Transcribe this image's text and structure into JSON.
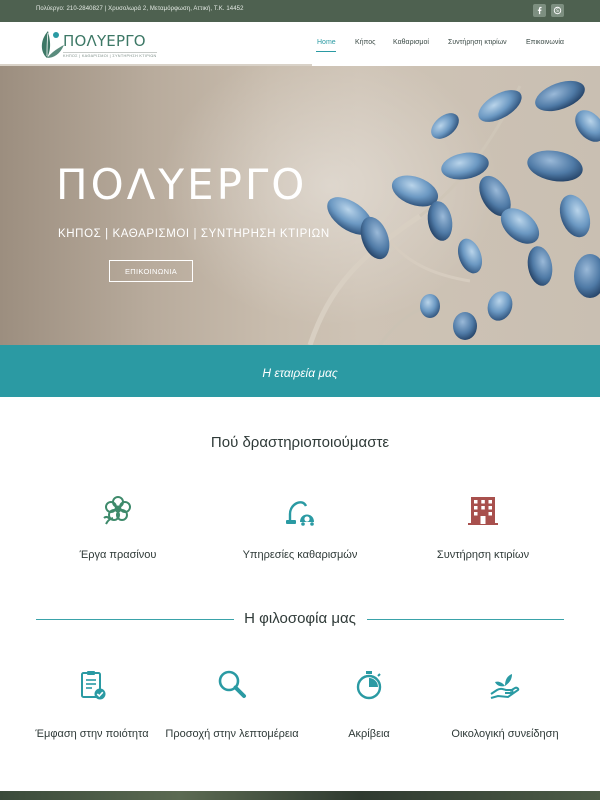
{
  "topbar": {
    "info": "Πολύεργο: 210-2840827 | Χρυσολωρά 2, Μεταμόρφωση, Αττική, Τ.Κ. 14452",
    "social": [
      "facebook-icon",
      "skype-icon"
    ]
  },
  "header": {
    "logo_text": "ΠΟΛΥΕΡΓΟ",
    "logo_sub": "ΚΗΠΟΣ | ΚΑΘΑΡΙΣΜΟΙ | ΣΥΝΤΗΡΗΣΗ ΚΤΙΡΙΩΝ",
    "nav": [
      "Home",
      "Κήπος",
      "Καθαρισμοί",
      "Συντήρηση κτιρίων",
      "Επικοινωνία"
    ],
    "active_nav": "Home"
  },
  "hero": {
    "title": "ΠΟΛΥΕΡΓΟ",
    "subtitle": "ΚΗΠΟΣ | ΚΑΘΑΡΙΣΜΟΙ | ΣΥΝΤΗΡΗΣΗ ΚΤΙΡΙΩΝ",
    "button": "ΕΠΙΚΟΙΝΩΝΙΑ"
  },
  "band": {
    "text": "Η εταιρεία μας"
  },
  "services": {
    "title": "Πού δραστηριοποιούμαστε",
    "items": [
      {
        "label": "Έργα πρασίνου",
        "icon": "flower-icon",
        "color": "#3e8a6b"
      },
      {
        "label": "Υπηρεσίες καθαρισμών",
        "icon": "vacuum-icon",
        "color": "#2a9aa3"
      },
      {
        "label": "Συντήρηση κτιρίων",
        "icon": "building-icon",
        "color": "#a8504d"
      }
    ]
  },
  "philosophy": {
    "title": "Η φιλοσοφία μας",
    "items": [
      {
        "label": "Έμφαση στην ποιότητα",
        "icon": "clipboard-check-icon"
      },
      {
        "label": "Προσοχή στην λεπτομέρεια",
        "icon": "magnifier-icon"
      },
      {
        "label": "Ακρίβεια",
        "icon": "stopwatch-icon"
      },
      {
        "label": "Οικολογική συνείδηση",
        "icon": "hand-plant-icon"
      }
    ],
    "color": "#2a9aa3"
  },
  "colors": {
    "topbar": "#4e6150",
    "accent": "#2b9aa3",
    "brand_green": "#3d7866"
  }
}
